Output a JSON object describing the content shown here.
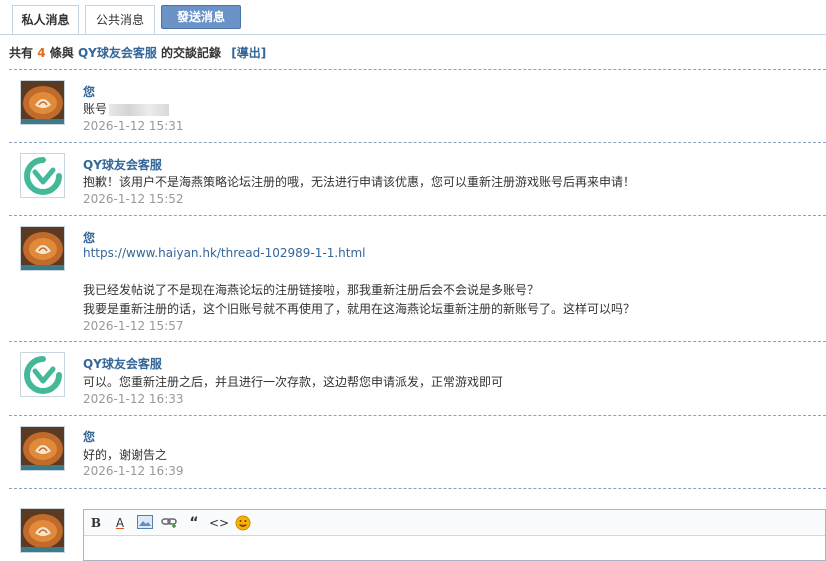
{
  "tabs": {
    "private": "私人消息",
    "public": "公共消息",
    "send": "發送消息"
  },
  "summary": {
    "prefix": "共有",
    "count": "4",
    "middle": "條與",
    "name": "QY球友会客服",
    "suffix": "的交談記錄",
    "export": "[導出]"
  },
  "messages": [
    {
      "author": "您",
      "lines": [
        "账号"
      ],
      "time": "2026-1-12 15:31"
    },
    {
      "author": "QY球友会客服",
      "lines": [
        "抱歉！该用户不是海燕策略论坛注册的哦，无法进行申请该优惠，您可以重新注册游戏账号后再来申请！"
      ],
      "time": "2026-1-12 15:52"
    },
    {
      "author": "您",
      "link": "https://www.haiyan.hk/thread-102989-1-1.html",
      "lines": [
        "我已经发帖说了不是现在海燕论坛的注册链接啦，那我重新注册后会不会说是多账号？",
        "我要是重新注册的话，这个旧账号就不再使用了，就用在这海燕论坛重新注册的新账号了。这样可以吗？"
      ],
      "time": "2026-1-12 15:57"
    },
    {
      "author": "QY球友会客服",
      "lines": [
        "可以。您重新注册之后，并且进行一次存款，这边帮您申请派发，正常游戏即可"
      ],
      "time": "2026-1-12 16:33"
    },
    {
      "author": "您",
      "lines": [
        "好的，谢谢告之"
      ],
      "time": "2026-1-12 16:39"
    }
  ],
  "editor": {
    "bold": "B",
    "font_color": "A",
    "quote": "“",
    "code": "<>"
  },
  "colors": {
    "accent": "#336699",
    "count": "#e36d1b",
    "send_button": "#6b93c8",
    "time": "#999999"
  }
}
